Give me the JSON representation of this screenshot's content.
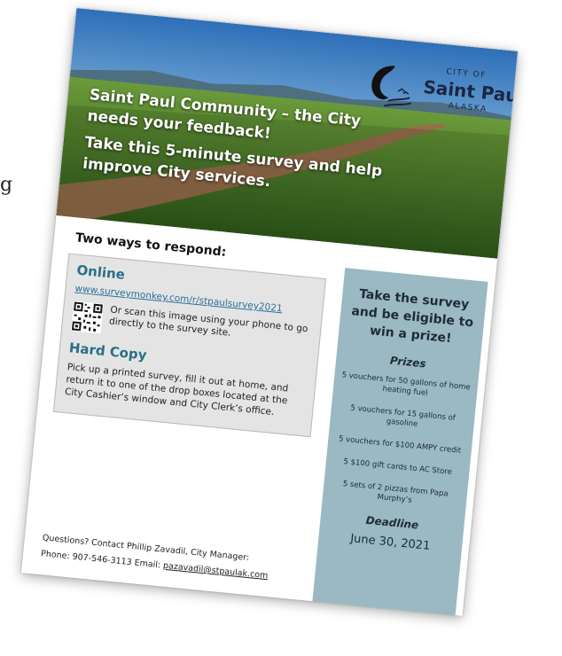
{
  "stray_text": "g",
  "flyer": {
    "hero": {
      "line1": "Saint Paul Community – the City needs your feedback!",
      "line2": "Take this 5-minute survey and help improve City services."
    },
    "logo": {
      "city_of": "CITY OF",
      "name": "Saint Paul",
      "state": "ALASKA"
    },
    "left": {
      "heading": "Two ways to respond:",
      "online_title": "Online",
      "url": "www.surveymonkey.com/r/stpaulsurvey2021",
      "scan_text": "Or scan this image using your phone to go directly to the survey site.",
      "hardcopy_title": "Hard Copy",
      "hardcopy_text": "Pick up a printed survey, fill it out at home, and return it to one of the drop boxes located at the City Cashier’s window and City Clerk’s office.",
      "contact_line1": "Questions? Contact Phillip Zavadil, City Manager:",
      "contact_phone": "Phone: 907-546-3113 Email: ",
      "contact_email": "pazavadil@stpaulak.com"
    },
    "right": {
      "title": "Take the survey and be eligible to win a prize!",
      "prizes_heading": "Prizes",
      "prizes": [
        "5 vouchers for 50 gallons of home heating fuel",
        "5 vouchers for 15 gallons of gasoline",
        "5 vouchers for $100 AMPY credit",
        "5 $100 gift cards to AC Store",
        "5 sets of 2 pizzas from Papa Murphy’s"
      ],
      "deadline_heading": "Deadline",
      "deadline": "June 30, 2021"
    },
    "colors": {
      "accent": "#2a6f86",
      "panel": "#9ab9c2",
      "logo": "#1b2540"
    }
  }
}
